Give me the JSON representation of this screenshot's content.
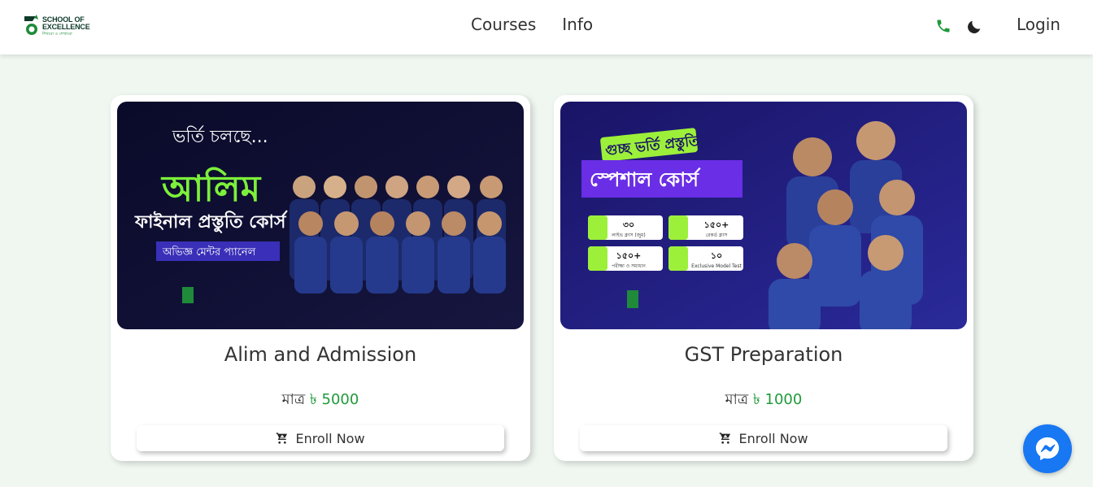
{
  "brand": {
    "logo_line1": "SCHOOL OF",
    "logo_line2": "EXCELLENCE",
    "logo_tagline": "শিখবো ও শেখাবো"
  },
  "nav": {
    "links": [
      {
        "label": "Courses"
      },
      {
        "label": "Info"
      }
    ],
    "login_label": "Login"
  },
  "icons": {
    "phone": "phone-icon",
    "theme": "moon-icon",
    "cart": "cart-icon",
    "messenger": "messenger-icon"
  },
  "colors": {
    "accent": "#1f9a3a",
    "page_bg": "#f0f7f1",
    "messenger": "#1877f2",
    "banner_dark": "#0c0c2e",
    "banner_purple": "#2c1f8f"
  },
  "courses": [
    {
      "title": "Alim and Admission",
      "price_label": "মাত্র",
      "price": "৳ 5000",
      "enroll_label": "Enroll Now",
      "banner": {
        "headline": "ভর্তি চলছে...",
        "big_text": "আলিম",
        "sub_text": "ফাইনাল প্রস্তুতি কোর্স",
        "tag": "অভিজ্ঞ মেন্টর প্যানেল"
      }
    },
    {
      "title": "GST Preparation",
      "price_label": "মাত্র",
      "price": "৳ 1000",
      "enroll_label": "Enroll Now",
      "banner": {
        "headline": "গুচ্ছ ভর্তি প্রস্তুতি",
        "big_text": "স্পেশাল কোর্স",
        "stats": [
          {
            "num": "৩০",
            "label": "লাইভ ক্লাস (জুম)"
          },
          {
            "num": "১৫০+",
            "label": "রেকর্ড ক্লাস"
          },
          {
            "num": "১৫০+",
            "label": "পরীক্ষা ও সমাধান"
          },
          {
            "num": "১০",
            "label": "Exclusive Model Test"
          }
        ]
      }
    }
  ]
}
